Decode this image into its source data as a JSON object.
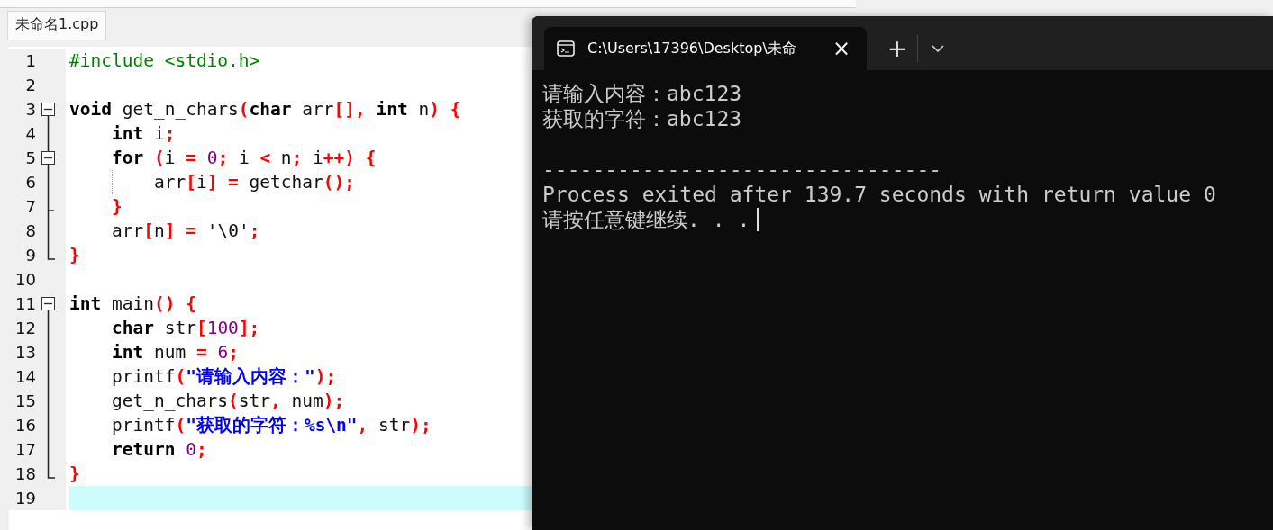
{
  "editor": {
    "tabs": [
      {
        "label": "未命名1.cpp",
        "selected": true
      }
    ],
    "lines": [
      {
        "number": "1",
        "current": false,
        "guide": false,
        "tokens": [
          {
            "kind": "pre",
            "t": "#include <stdio.h>"
          }
        ]
      },
      {
        "number": "2",
        "current": false,
        "guide": false
      },
      {
        "number": "3",
        "fold": {
          "kind": "open"
        },
        "current": false,
        "guide": false,
        "tokens": [
          {
            "kind": "kw",
            "t": "void"
          },
          {
            "kind": "id",
            "t": " get_n_chars"
          },
          {
            "kind": "sym",
            "t": "("
          },
          {
            "kind": "kw",
            "t": "char"
          },
          {
            "kind": "id",
            "t": " arr"
          },
          {
            "kind": "sym",
            "t": "[],"
          },
          {
            "kind": "kw",
            "t": " int"
          },
          {
            "kind": "id",
            "t": " n"
          },
          {
            "kind": "sym",
            "t": ") {"
          }
        ]
      },
      {
        "number": "4",
        "fold": {
          "kind": "line"
        },
        "current": false,
        "guide": false,
        "tokens": [
          {
            "kind": "kw",
            "t": "    int"
          },
          {
            "kind": "id",
            "t": " i"
          },
          {
            "kind": "sym",
            "t": ";"
          }
        ]
      },
      {
        "number": "5",
        "fold": {
          "kind": "open-nested"
        },
        "current": false,
        "guide": false,
        "tokens": [
          {
            "kind": "kw",
            "t": "    for"
          },
          {
            "kind": "sym",
            "t": " ("
          },
          {
            "kind": "id",
            "t": "i "
          },
          {
            "kind": "sym",
            "t": "="
          },
          {
            "kind": "num",
            "t": " 0"
          },
          {
            "kind": "sym",
            "t": ";"
          },
          {
            "kind": "id",
            "t": " i "
          },
          {
            "kind": "sym",
            "t": "<"
          },
          {
            "kind": "id",
            "t": " n"
          },
          {
            "kind": "sym",
            "t": ";"
          },
          {
            "kind": "id",
            "t": " i"
          },
          {
            "kind": "sym",
            "t": "++) {"
          }
        ]
      },
      {
        "number": "6",
        "fold": {
          "kind": "line"
        },
        "current": false,
        "guide": true,
        "tokens": [
          {
            "kind": "id",
            "t": "        arr"
          },
          {
            "kind": "sym",
            "t": "["
          },
          {
            "kind": "id",
            "t": "i"
          },
          {
            "kind": "sym",
            "t": "] ="
          },
          {
            "kind": "id",
            "t": " getchar"
          },
          {
            "kind": "sym",
            "t": "();"
          }
        ]
      },
      {
        "number": "7",
        "fold": {
          "kind": "tee"
        },
        "current": false,
        "guide": false,
        "tokens": [
          {
            "kind": "sym",
            "t": "    }"
          }
        ]
      },
      {
        "number": "8",
        "fold": {
          "kind": "line"
        },
        "current": false,
        "guide": false,
        "tokens": [
          {
            "kind": "id",
            "t": "    arr"
          },
          {
            "kind": "sym",
            "t": "["
          },
          {
            "kind": "id",
            "t": "n"
          },
          {
            "kind": "sym",
            "t": "] ="
          },
          {
            "kind": "id",
            "t": " '\\0'"
          },
          {
            "kind": "sym",
            "t": ";"
          }
        ]
      },
      {
        "number": "9",
        "fold": {
          "kind": "end"
        },
        "current": false,
        "guide": false,
        "tokens": [
          {
            "kind": "sym",
            "t": "}"
          }
        ]
      },
      {
        "number": "10",
        "current": false,
        "guide": false
      },
      {
        "number": "11",
        "fold": {
          "kind": "open"
        },
        "current": false,
        "guide": false,
        "tokens": [
          {
            "kind": "kw",
            "t": "int"
          },
          {
            "kind": "id",
            "t": " main"
          },
          {
            "kind": "sym",
            "t": "() {"
          }
        ]
      },
      {
        "number": "12",
        "fold": {
          "kind": "line"
        },
        "current": false,
        "guide": false,
        "tokens": [
          {
            "kind": "kw",
            "t": "    char"
          },
          {
            "kind": "id",
            "t": " str"
          },
          {
            "kind": "sym",
            "t": "["
          },
          {
            "kind": "num",
            "t": "100"
          },
          {
            "kind": "sym",
            "t": "];"
          }
        ]
      },
      {
        "number": "13",
        "fold": {
          "kind": "line"
        },
        "current": false,
        "guide": false,
        "tokens": [
          {
            "kind": "kw",
            "t": "    int"
          },
          {
            "kind": "id",
            "t": " num "
          },
          {
            "kind": "sym",
            "t": "="
          },
          {
            "kind": "num",
            "t": " 6"
          },
          {
            "kind": "sym",
            "t": ";"
          }
        ]
      },
      {
        "number": "14",
        "fold": {
          "kind": "line"
        },
        "current": false,
        "guide": false,
        "tokens": [
          {
            "kind": "id",
            "t": "    printf"
          },
          {
            "kind": "sym",
            "t": "("
          },
          {
            "kind": "str",
            "t": "\"请输入内容：\""
          },
          {
            "kind": "sym",
            "t": ");"
          }
        ]
      },
      {
        "number": "15",
        "fold": {
          "kind": "line"
        },
        "current": false,
        "guide": false,
        "tokens": [
          {
            "kind": "id",
            "t": "    get_n_chars"
          },
          {
            "kind": "sym",
            "t": "("
          },
          {
            "kind": "id",
            "t": "str"
          },
          {
            "kind": "sym",
            "t": ","
          },
          {
            "kind": "id",
            "t": " num"
          },
          {
            "kind": "sym",
            "t": ");"
          }
        ]
      },
      {
        "number": "16",
        "fold": {
          "kind": "line"
        },
        "current": false,
        "guide": false,
        "tokens": [
          {
            "kind": "id",
            "t": "    printf"
          },
          {
            "kind": "sym",
            "t": "("
          },
          {
            "kind": "str",
            "t": "\"获取的字符：%s\\n\""
          },
          {
            "kind": "sym",
            "t": ","
          },
          {
            "kind": "id",
            "t": " str"
          },
          {
            "kind": "sym",
            "t": ");"
          }
        ]
      },
      {
        "number": "17",
        "fold": {
          "kind": "line"
        },
        "current": false,
        "guide": false,
        "tokens": [
          {
            "kind": "kw",
            "t": "    return"
          },
          {
            "kind": "num",
            "t": " 0"
          },
          {
            "kind": "sym",
            "t": ";"
          }
        ]
      },
      {
        "number": "18",
        "fold": {
          "kind": "end"
        },
        "current": false,
        "guide": false,
        "tokens": [
          {
            "kind": "sym",
            "t": "}"
          }
        ]
      },
      {
        "number": "19",
        "current": true,
        "guide": false
      }
    ]
  },
  "terminal": {
    "tab_title": "C:\\Users\\17396\\Desktop\\未命",
    "close": "×",
    "new_tab": "+",
    "output": [
      {
        "text": "请输入内容：abc123",
        "gap_before": false,
        "cursor": false
      },
      {
        "text": "获取的字符：abc123",
        "gap_before": false,
        "cursor": false
      },
      {
        "text": "--------------------------------",
        "gap_before": true,
        "cursor": false
      },
      {
        "text": "Process exited after 139.7 seconds with return value 0",
        "gap_before": false,
        "cursor": false
      },
      {
        "text": "请按任意键继续. . .",
        "gap_before": false,
        "cursor": true
      }
    ]
  }
}
